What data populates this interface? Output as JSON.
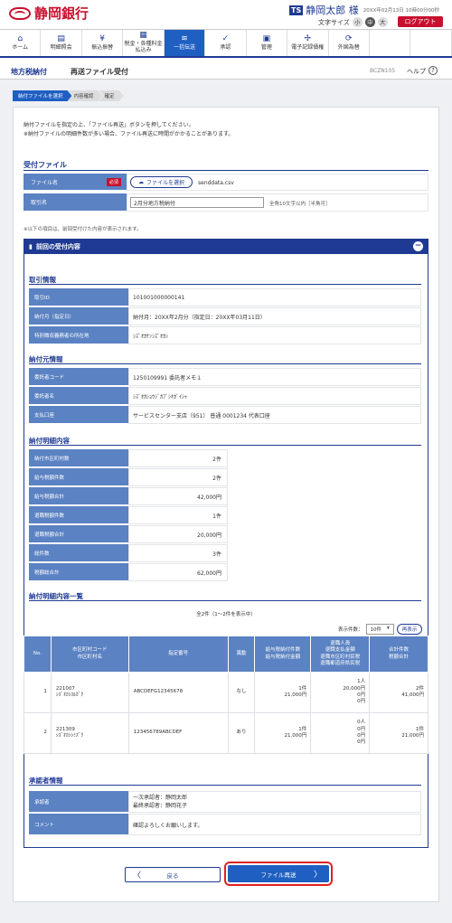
{
  "header": {
    "bank_name": "静岡銀行",
    "user_badge": "TS",
    "user_name": "静岡太郎 様",
    "last_login": "20XX年02月13日 10時00分00秒",
    "font_size_label": "文字サイズ",
    "font_sizes": [
      "小",
      "中",
      "大"
    ],
    "logout": "ログアウト"
  },
  "nav": [
    {
      "label": "ホーム",
      "icon": "home-icon",
      "glyph": "⌂"
    },
    {
      "label": "明細照会",
      "icon": "document-icon",
      "glyph": "▤"
    },
    {
      "label": "振込振替",
      "icon": "yen-icon",
      "glyph": "¥"
    },
    {
      "label": "税金・各種料金\n払込み",
      "icon": "invoice-icon",
      "glyph": "▦"
    },
    {
      "label": "一括伝送",
      "icon": "database-icon",
      "glyph": "≋"
    },
    {
      "label": "承認",
      "icon": "check-icon",
      "glyph": "✓"
    },
    {
      "label": "管理",
      "icon": "admin-icon",
      "glyph": "▣"
    },
    {
      "label": "電子記録債権",
      "icon": "network-icon",
      "glyph": "✢"
    },
    {
      "label": "外国為替",
      "icon": "exchange-icon",
      "glyph": "⟳"
    },
    {
      "label": "",
      "icon": "blank-icon",
      "glyph": ""
    },
    {
      "label": "",
      "icon": "blank-icon",
      "glyph": ""
    }
  ],
  "title_bar": {
    "category": "地方税納付",
    "page": "再送ファイル受付",
    "code": "BCZN105",
    "help": "ヘルプ",
    "help_icon": "?"
  },
  "steps": [
    "納付ファイルを選択",
    "内容確認",
    "確定"
  ],
  "instructions": [
    "納付ファイルを指定の上、「ファイル再送」ボタンを押してください。",
    "※納付ファイルの明細件数が多い場合、ファイル再送に時間がかかることがあります。"
  ],
  "upload": {
    "section_title": "受付ファイル",
    "file_label": "ファイル名",
    "required": "必須",
    "file_button": "ファイルを選択",
    "file_name": "senddata.csv",
    "name_label": "取引名",
    "name_value": "2月分地方税納付",
    "name_hint": "全角10文字以内［半角可］"
  },
  "note_prev": "※以下の項目は、前回受付けた内容が表示されます。",
  "prev": {
    "title": "前回の受付内容",
    "collapse": "−",
    "trans_section": "取引情報",
    "trans": [
      {
        "label": "取引ID",
        "value": "101001000000141"
      },
      {
        "label": "納付月（指定日）",
        "value": "納付月：20XX年2月分（指定日：20XX年03月11日）"
      },
      {
        "label": "特別徴収義務者の所在地",
        "value": "ｼｽﾞｵｶｹﾝｼｽﾞｵｶｼ"
      }
    ],
    "payer_section": "納付元情報",
    "payer": [
      {
        "label": "委託者コード",
        "value": "1250109991 委託者メモ１"
      },
      {
        "label": "委託者名",
        "value": "ｼｽﾞｵｶｼｮｳｼﾞｶﾌﾞｼｷｶﾞｲｼｬ"
      },
      {
        "label": "支払口座",
        "value": "サービスセンター支店（951） 普通 0001234 代表口座"
      }
    ],
    "detail_section": "納付明細内容",
    "detail": [
      {
        "label": "納付市区町村数",
        "value": "2件"
      },
      {
        "label": "給与税額件数",
        "value": "2件"
      },
      {
        "label": "給与税額合計",
        "value": "42,000円"
      },
      {
        "label": "退職税額件数",
        "value": "1件"
      },
      {
        "label": "退職税額合計",
        "value": "20,000円"
      },
      {
        "label": "総件数",
        "value": "3件"
      },
      {
        "label": "税額総合計",
        "value": "62,000円"
      }
    ],
    "list_section": "納付明細内容一覧",
    "list_count": "全2件（1～2件を表示中）",
    "per_page_label": "表示件数：",
    "per_page_value": "10件",
    "redisplay": "再表示",
    "columns": [
      "No.",
      "市区町村コード\n市区町村名",
      "指定番号",
      "異動",
      "給与税納付件数\n給与税納付金額",
      "退職人員\n退職支払金額\n退職市区町村民税\n退職都道府県民税",
      "合計件数\n税額合計"
    ],
    "rows": [
      {
        "no": "1",
        "code": "221007",
        "city": "ｼｽﾞｵｶｼｽﾙｶﾞｸ",
        "num": "ABCDEFG12345678",
        "change": "なし",
        "sal_count": "1件",
        "sal_amount": "21,000円",
        "ret_people": "1人",
        "ret_paid": "20,000円",
        "ret_city": "0円",
        "ret_pref": "0円",
        "total_count": "2件",
        "total_amount": "41,000円"
      },
      {
        "no": "2",
        "code": "221309",
        "city": "ｼｽﾞｵｶｼｼﾐｽﾞｸ",
        "num": "123456789ABCDEF",
        "change": "あり",
        "sal_count": "1件",
        "sal_amount": "21,000円",
        "ret_people": "0人",
        "ret_paid": "0円",
        "ret_city": "0円",
        "ret_pref": "0円",
        "total_count": "1件",
        "total_amount": "21,000円"
      }
    ],
    "approver_section": "承認者情報",
    "approver_label": "承認者",
    "approver_1": "一次承認者：静岡太郎",
    "approver_2": "最終承認者：静岡花子",
    "comment_label": "コメント",
    "comment_value": "確認よろしくお願いします。"
  },
  "buttons": {
    "back": "戻る",
    "back_glyph": "〈",
    "send": "ファイル再送",
    "send_glyph": "〉"
  }
}
